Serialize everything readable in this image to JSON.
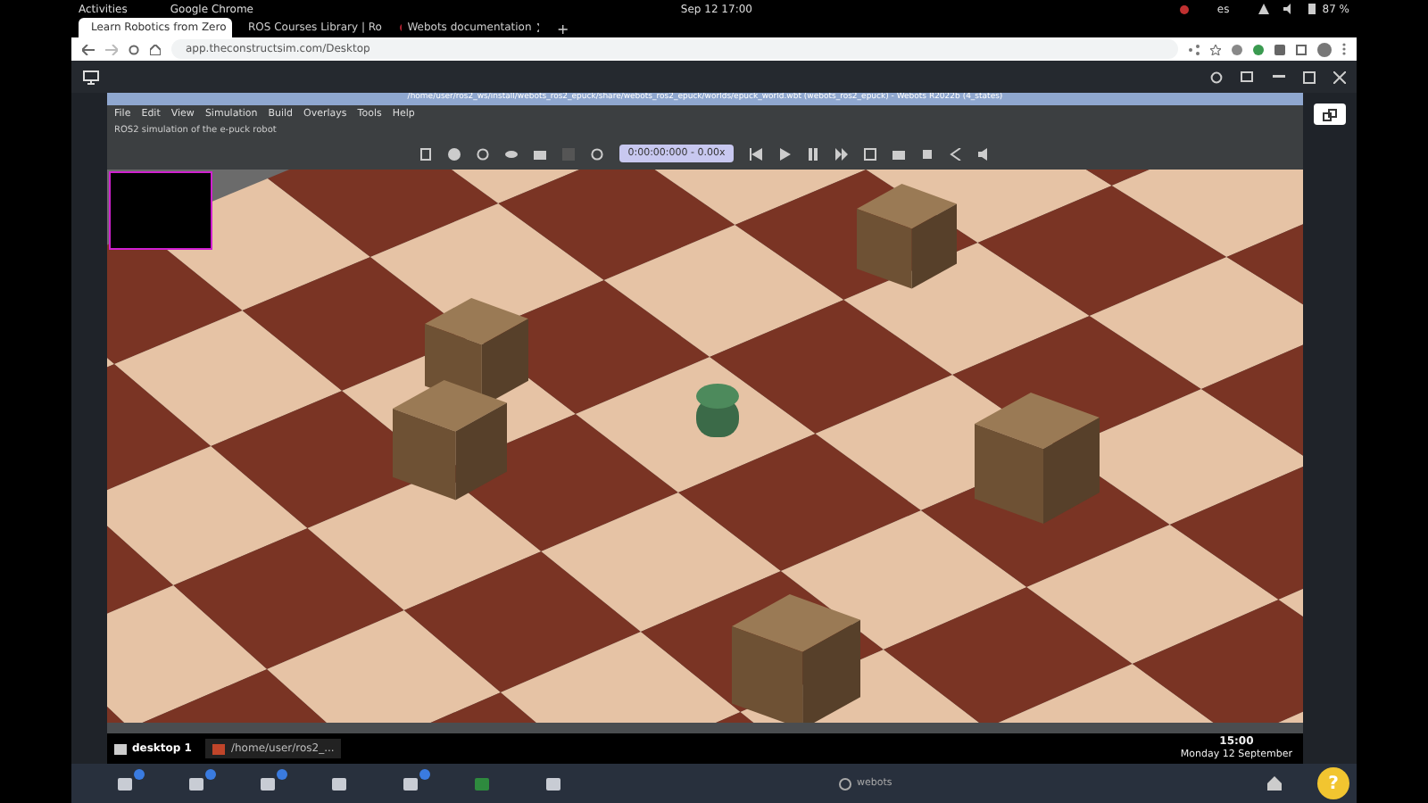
{
  "system_bar": {
    "activities": "Activities",
    "app": "Google Chrome",
    "clock": "Sep 12  17:00",
    "keyboard": "es",
    "battery": "87 %"
  },
  "browser": {
    "tabs": [
      {
        "title": "Learn Robotics from Zero",
        "selected": true
      },
      {
        "title": "ROS Courses Library | Ro",
        "selected": false
      },
      {
        "title": "Webots documentation",
        "selected": false
      }
    ],
    "new_tab": "+",
    "url": "app.theconstructsim.com/Desktop"
  },
  "webots": {
    "title": "/home/user/ros2_ws/install/webots_ros2_epuck/share/webots_ros2_epuck/worlds/epuck_world.wbt (webots_ros2_epuck) - Webots R2022b (4_states)",
    "menu": [
      "File",
      "Edit",
      "View",
      "Simulation",
      "Build",
      "Overlays",
      "Tools",
      "Help"
    ],
    "description": "ROS2 simulation of the e-puck robot",
    "time": "0:00:00:000  -  0.00x"
  },
  "desktop_tabs": [
    {
      "label": "desktop 1",
      "selected": true
    },
    {
      "label": "/home/user/ros2_...",
      "selected": false
    }
  ],
  "clock": {
    "time": "15:00",
    "date": "Monday 12 September"
  },
  "dock": {
    "app_label": "webots",
    "help": "?"
  }
}
